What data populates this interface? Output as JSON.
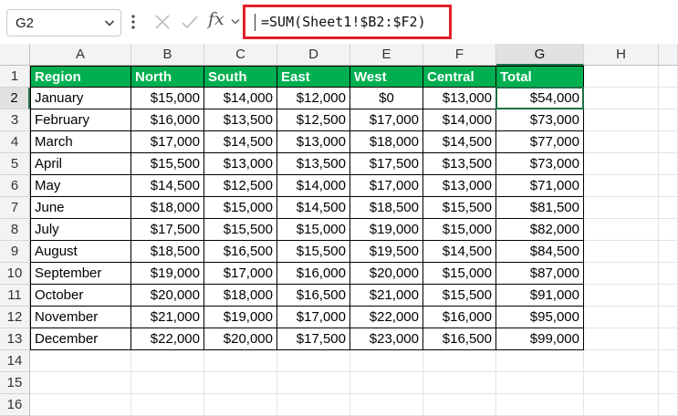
{
  "formula_bar": {
    "name_box": "G2",
    "fx_label": "fx",
    "formula": "=SUM(Sheet1!$B2:$F2)"
  },
  "sheet": {
    "column_letters": [
      "A",
      "B",
      "C",
      "D",
      "E",
      "F",
      "G",
      "H"
    ],
    "row_numbers": [
      "1",
      "2",
      "3",
      "4",
      "5",
      "6",
      "7",
      "8",
      "9",
      "10",
      "11",
      "12",
      "13",
      "14",
      "15",
      "16"
    ],
    "selected_cell": "G2",
    "header_fill_color": "#00b050",
    "header_text_color": "#ffffff",
    "selection_color": "#1e7145",
    "highlight_color": "#e0202a",
    "headers": [
      "Region",
      "North",
      "South",
      "East",
      "West",
      "Central",
      "Total"
    ],
    "rows": [
      [
        "January",
        "$15,000",
        "$14,000",
        "$12,000",
        "$0",
        "$13,000",
        "$54,000"
      ],
      [
        "February",
        "$16,000",
        "$13,500",
        "$12,500",
        "$17,000",
        "$14,000",
        "$73,000"
      ],
      [
        "March",
        "$17,000",
        "$14,500",
        "$13,000",
        "$18,000",
        "$14,500",
        "$77,000"
      ],
      [
        "April",
        "$15,500",
        "$13,000",
        "$13,500",
        "$17,500",
        "$13,500",
        "$73,000"
      ],
      [
        "May",
        "$14,500",
        "$12,500",
        "$14,000",
        "$17,000",
        "$13,000",
        "$71,000"
      ],
      [
        "June",
        "$18,000",
        "$15,000",
        "$14,500",
        "$18,500",
        "$15,500",
        "$81,500"
      ],
      [
        "July",
        "$17,500",
        "$15,500",
        "$15,000",
        "$19,000",
        "$15,000",
        "$82,000"
      ],
      [
        "August",
        "$18,500",
        "$16,500",
        "$15,500",
        "$19,500",
        "$14,500",
        "$84,500"
      ],
      [
        "September",
        "$19,000",
        "$17,000",
        "$16,000",
        "$20,000",
        "$15,000",
        "$87,000"
      ],
      [
        "October",
        "$20,000",
        "$18,000",
        "$16,500",
        "$21,000",
        "$15,500",
        "$91,000"
      ],
      [
        "November",
        "$21,000",
        "$19,000",
        "$17,000",
        "$22,000",
        "$16,000",
        "$95,000"
      ],
      [
        "December",
        "$22,000",
        "$20,000",
        "$17,500",
        "$23,000",
        "$16,500",
        "$99,000"
      ]
    ]
  }
}
